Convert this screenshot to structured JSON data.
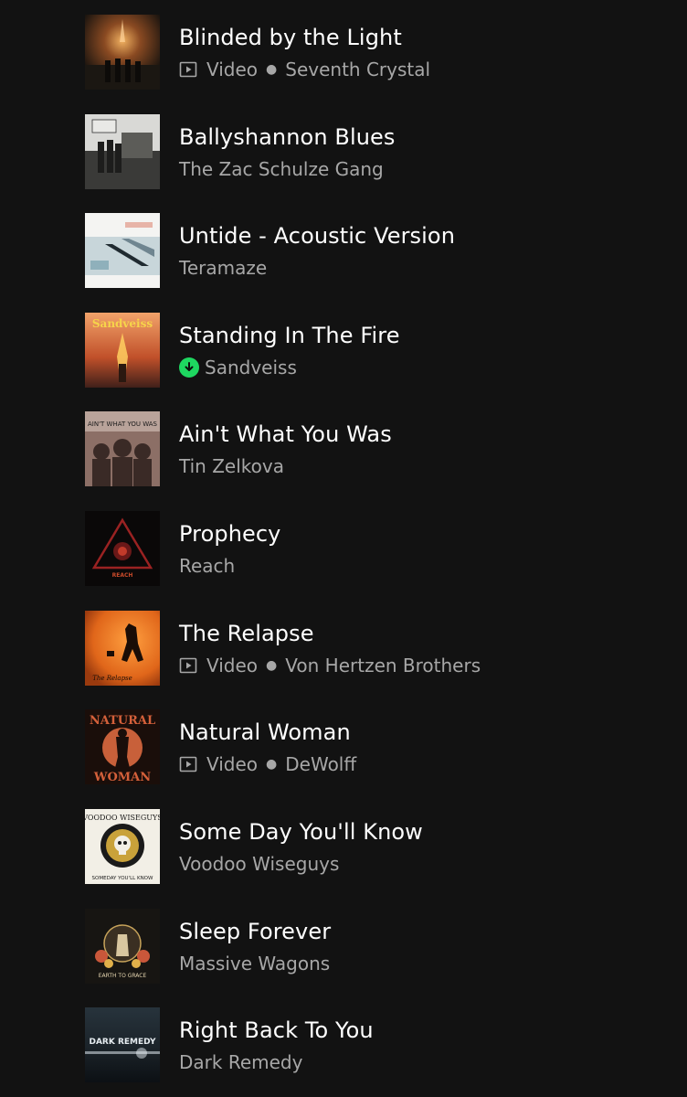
{
  "colors": {
    "background": "#121212",
    "title": "#ffffff",
    "subtitle": "#a7a7a7",
    "download": "#1ed760"
  },
  "tracks": [
    {
      "title": "Blinded by the Light",
      "kind": "Video",
      "artist": "Seventh Crystal",
      "meta_icon": "video-icon",
      "cover_text": ""
    },
    {
      "title": "Ballyshannon Blues",
      "kind": "",
      "artist": "The Zac Schulze Gang",
      "meta_icon": "",
      "cover_text": ""
    },
    {
      "title": "Untide - Acoustic Version",
      "kind": "",
      "artist": "Teramaze",
      "meta_icon": "",
      "cover_text": ""
    },
    {
      "title": "Standing In The Fire",
      "kind": "",
      "artist": "Sandveiss",
      "meta_icon": "downloaded-icon",
      "cover_text": "Sandveiss"
    },
    {
      "title": "Ain't What You Was",
      "kind": "",
      "artist": "Tin Zelkova",
      "meta_icon": "",
      "cover_text": "AIN'T WHAT YOU WAS"
    },
    {
      "title": "Prophecy",
      "kind": "",
      "artist": "Reach",
      "meta_icon": "",
      "cover_text": ""
    },
    {
      "title": "The Relapse",
      "kind": "Video",
      "artist": "Von Hertzen Brothers",
      "meta_icon": "video-icon",
      "cover_text": "The Relapse"
    },
    {
      "title": "Natural Woman",
      "kind": "Video",
      "artist": "DeWolff",
      "meta_icon": "video-icon",
      "cover_text": ""
    },
    {
      "title": "Some Day You'll Know",
      "kind": "",
      "artist": "Voodoo Wiseguys",
      "meta_icon": "",
      "cover_text": ""
    },
    {
      "title": "Sleep Forever",
      "kind": "",
      "artist": "Massive Wagons",
      "meta_icon": "",
      "cover_text": "EARTH TO GRACE"
    },
    {
      "title": "Right Back To You",
      "kind": "",
      "artist": "Dark Remedy",
      "meta_icon": "",
      "cover_text": "DARK REMEDY"
    }
  ],
  "covers": {
    "natural_top": "NATURAL",
    "natural_bottom": "WOMAN",
    "voodoo_top": "VOODOO WISEGUYS",
    "voodoo_bottom": "SOMEDAY YOU'LL KNOW",
    "reach_label": "REACH"
  }
}
